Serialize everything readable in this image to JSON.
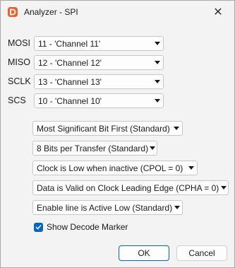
{
  "window": {
    "title": "Analyzer - SPI",
    "close_glyph": "✕",
    "accent_color": "#0067c0",
    "icon_color": "#e8602c"
  },
  "channels": [
    {
      "label": "MOSI",
      "value": "11 - 'Channel 11'"
    },
    {
      "label": "MISO",
      "value": "12 - 'Channel 12'"
    },
    {
      "label": "SCLK",
      "value": "13 - 'Channel 13'"
    },
    {
      "label": "SCS",
      "value": "10 - 'Channel 10'"
    }
  ],
  "settings": {
    "bit_order": "Most Significant Bit First (Standard)",
    "bits_per_transfer": "8 Bits per Transfer (Standard)",
    "cpol": "Clock is Low when inactive (CPOL = 0)",
    "cpha": "Data is Valid on Clock Leading Edge (CPHA = 0)",
    "enable_line": "Enable line is Active Low (Standard)"
  },
  "decode_marker": {
    "label": "Show Decode Marker",
    "checked": true
  },
  "buttons": {
    "ok": "OK",
    "cancel": "Cancel"
  }
}
